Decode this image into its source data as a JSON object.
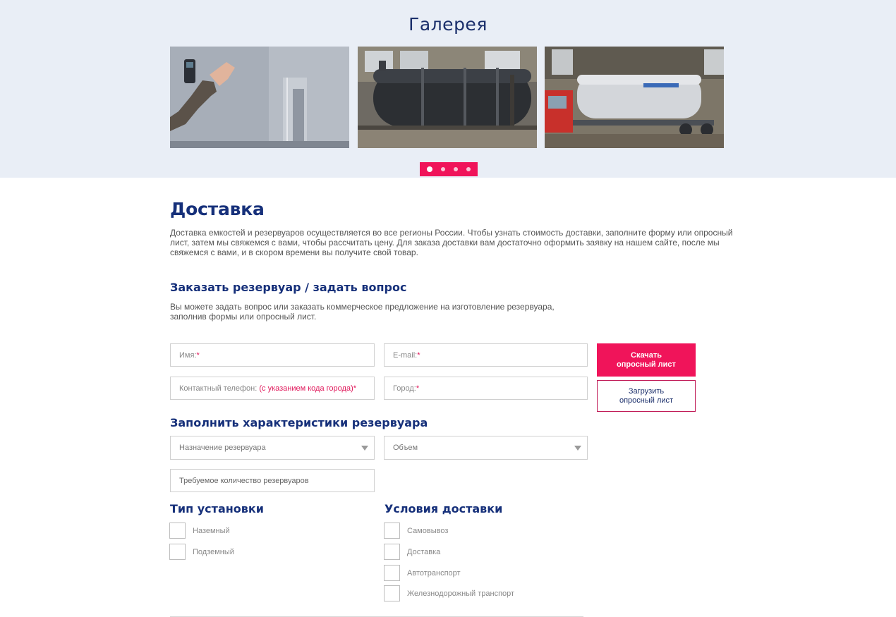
{
  "gallery": {
    "title": "Галерея",
    "photos": [
      {
        "name": "photo-wall-thickness-test"
      },
      {
        "name": "photo-black-tank-workshop"
      },
      {
        "name": "photo-white-tank-on-trailer"
      }
    ],
    "dots": 4,
    "active_dot": 0,
    "accent": "#f0145a"
  },
  "delivery": {
    "title": "Доставка",
    "text": "Доставка емкостей и резервуаров осуществляется во все регионы России. Чтобы узнать стоимость доставки, заполните форму или опросный лист, затем мы свяжемся с вами, чтобы рассчитать цену. Для заказа доставки вам достаточно оформить заявку на нашем сайте, после мы свяжемся с вами, и в скором времени вы получите свой товар."
  },
  "order": {
    "title": "Заказать резервуар / задать вопрос",
    "text": "Вы можете задать вопрос или заказать коммерческое предложение на изготовление резервуара, заполнив формы или опросный лист.",
    "fields": {
      "name_placeholder": "Имя:",
      "email_placeholder": "E-mail:",
      "phone_placeholder": "Контактный телефон:",
      "phone_hint": "(с указанием кода города)",
      "city_placeholder": "Город:",
      "required_mark": "*"
    },
    "download_button": "Скачать\nопросный лист",
    "upload_button": "Загрузить\nопросный лист"
  },
  "characteristics": {
    "title": "Заполнить характеристики резервуара",
    "purpose_select": "Назначение резервуара",
    "volume_select": "Объем",
    "quantity_placeholder": "Требуемое количество резервуаров"
  },
  "install_type": {
    "title": "Тип установки",
    "options": [
      "Наземный",
      "Подземный"
    ]
  },
  "delivery_conditions": {
    "title": "Условия доставки",
    "options": [
      "Самовывоз",
      "Доставка",
      "Автотранспорт",
      "Железнодорожный транспорт"
    ]
  },
  "colors": {
    "accent": "#f0145a",
    "heading": "#16307a",
    "gallery_bg": "#e9eef6"
  }
}
